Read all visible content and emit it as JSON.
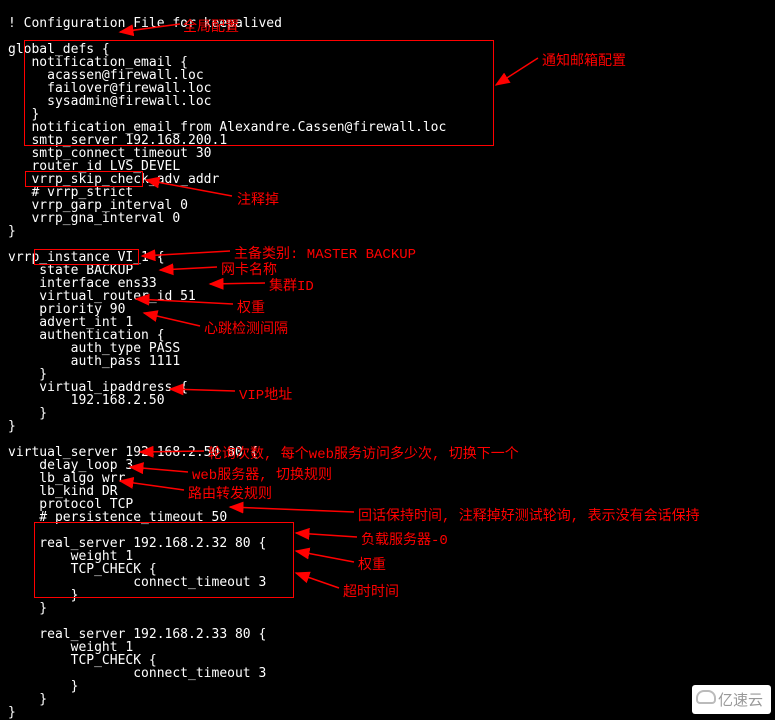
{
  "config_lines": [
    "! Configuration File for keepalived",
    "",
    "global_defs {",
    "   notification_email {",
    "     acassen@firewall.loc",
    "     failover@firewall.loc",
    "     sysadmin@firewall.loc",
    "   }",
    "   notification_email_from Alexandre.Cassen@firewall.loc",
    "   smtp_server 192.168.200.1",
    "   smtp_connect_timeout 30",
    "   router_id LVS_DEVEL",
    "   vrrp_skip_check_adv_addr",
    "   # vrrp_strict",
    "   vrrp_garp_interval 0",
    "   vrrp_gna_interval 0",
    "}",
    "",
    "vrrp_instance VI_1 {",
    "    state BACKUP",
    "    interface ens33",
    "    virtual_router_id 51",
    "    priority 90",
    "    advert_int 1",
    "    authentication {",
    "        auth_type PASS",
    "        auth_pass 1111",
    "    }",
    "    virtual_ipaddress {",
    "        192.168.2.50",
    "    }",
    "}",
    "",
    "virtual_server 192.168.2.50 80 {",
    "    delay_loop 3",
    "    lb_algo wrr",
    "    lb_kind DR",
    "    protocol TCP",
    "    # persistence_timeout 50",
    "",
    "    real_server 192.168.2.32 80 {",
    "        weight 1",
    "        TCP_CHECK {",
    "                connect_timeout 3",
    "        }",
    "    }",
    "",
    "    real_server 192.168.2.33 80 {",
    "        weight 1",
    "        TCP_CHECK {",
    "                connect_timeout 3",
    "        }",
    "    }",
    "}"
  ],
  "annotations": {
    "global_config": "全局配置",
    "mail_config": "通知邮箱配置",
    "comment_out": "注释掉",
    "master_backup": "主备类别: MASTER  BACKUP",
    "nic_name": "网卡名称",
    "cluster_id": "集群ID",
    "weight": "权重",
    "heartbeat": "心跳检测间隔",
    "vip_addr": "VIP地址",
    "poll_count": "轮询次数, 每个web服务访问多少次, 切换下一个",
    "web_switch": "web服务器, 切换规则",
    "route_rule": "路由转发规则",
    "session_keep": "回话保持时间, 注释掉好测试轮询, 表示没有会话保持",
    "load_server0": "负载服务器-0",
    "weight2": "权重",
    "timeout": "超时时间"
  },
  "logo_text": "亿速云"
}
